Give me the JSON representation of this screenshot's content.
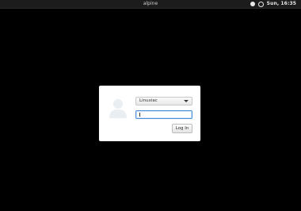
{
  "topbar": {
    "hostname": "alpine",
    "clock": "Sun, 16:35",
    "icons": [
      "accessibility-icon",
      "power-icon"
    ]
  },
  "login": {
    "user_select_value": "Linuxiac",
    "password_value": "",
    "login_button_label": "Log In",
    "avatar_icon": "user-avatar-icon"
  },
  "colors": {
    "background": "#000000",
    "topbar": "#1c1c1c",
    "dialog": "#ffffff",
    "focus_border": "#4a90d9"
  }
}
